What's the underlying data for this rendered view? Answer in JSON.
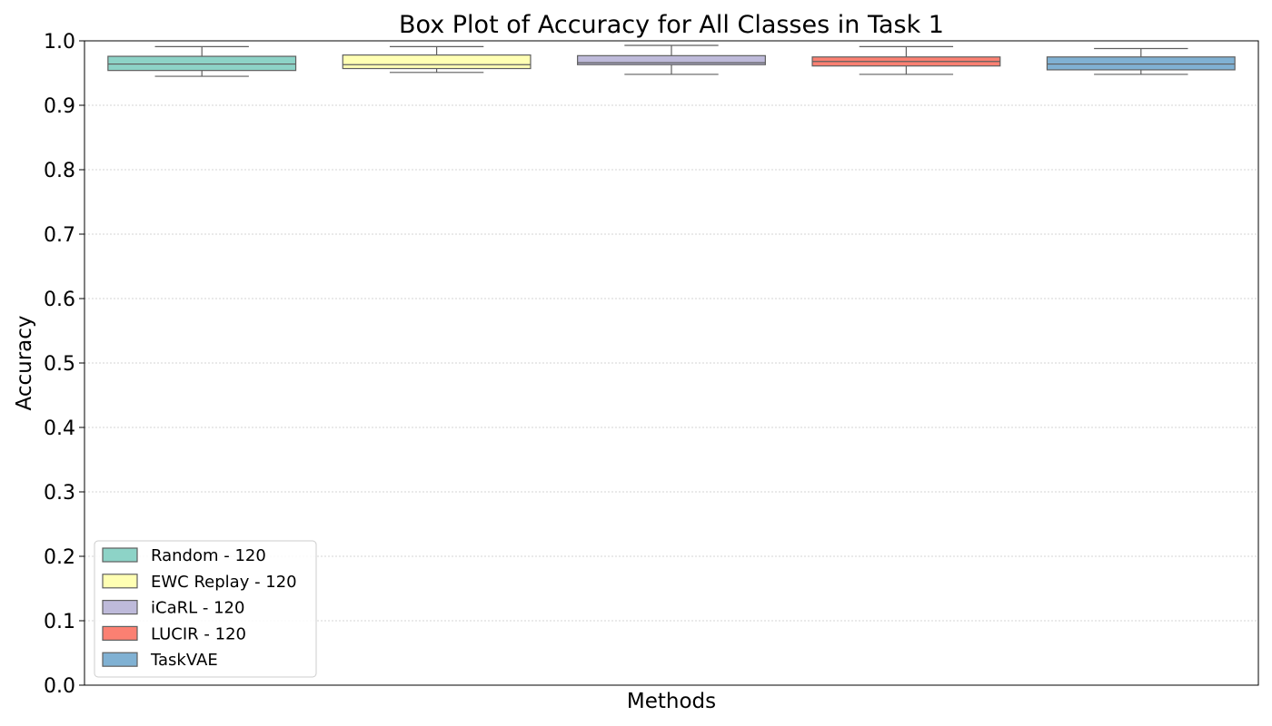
{
  "chart_data": {
    "type": "box",
    "title": "Box Plot of Accuracy for All Classes in Task 1",
    "xlabel": "Methods",
    "ylabel": "Accuracy",
    "ylim": [
      0.0,
      1.0
    ],
    "yticks": [
      0.0,
      0.1,
      0.2,
      0.3,
      0.4,
      0.5,
      0.6,
      0.7,
      0.8,
      0.9,
      1.0
    ],
    "ytick_labels": [
      "0.0",
      "0.1",
      "0.2",
      "0.3",
      "0.4",
      "0.5",
      "0.6",
      "0.7",
      "0.8",
      "0.9",
      "1.0"
    ],
    "grid": "horizontal dotted",
    "legend_position": "lower-left",
    "series": [
      {
        "name": "Random - 120",
        "color": "#8dd3c7",
        "whisker_low": 0.945,
        "q1": 0.954,
        "median": 0.964,
        "q3": 0.976,
        "whisker_high": 0.991
      },
      {
        "name": "EWC Replay - 120",
        "color": "#ffffb3",
        "whisker_low": 0.951,
        "q1": 0.957,
        "median": 0.963,
        "q3": 0.978,
        "whisker_high": 0.991
      },
      {
        "name": "iCaRL - 120",
        "color": "#bebada",
        "whisker_low": 0.948,
        "q1": 0.963,
        "median": 0.966,
        "q3": 0.977,
        "whisker_high": 0.993
      },
      {
        "name": "LUCIR - 120",
        "color": "#fb8072",
        "whisker_low": 0.948,
        "q1": 0.961,
        "median": 0.968,
        "q3": 0.975,
        "whisker_high": 0.991
      },
      {
        "name": "TaskVAE",
        "color": "#80b1d3",
        "whisker_low": 0.948,
        "q1": 0.955,
        "median": 0.964,
        "q3": 0.975,
        "whisker_high": 0.988
      }
    ]
  }
}
